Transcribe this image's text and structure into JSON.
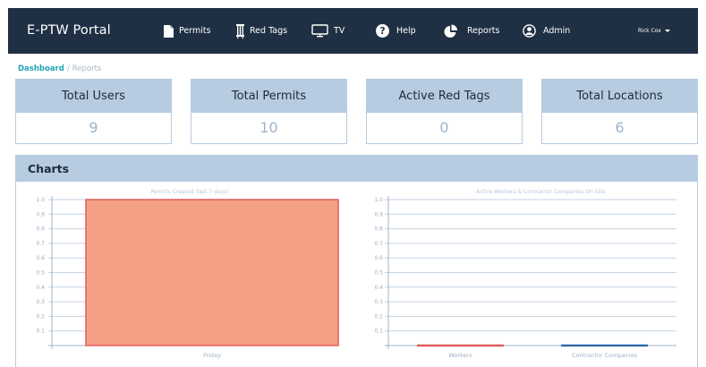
{
  "app": {
    "brand": "E-PTW Portal"
  },
  "nav": {
    "items": [
      {
        "label": "Permits",
        "icon": "document-icon"
      },
      {
        "label": "Red Tags",
        "icon": "tag-icon"
      },
      {
        "label": "TV",
        "icon": "monitor-icon"
      },
      {
        "label": "Help",
        "icon": "help-icon"
      },
      {
        "label": "Reports",
        "icon": "pie-chart-icon"
      },
      {
        "label": "Admin",
        "icon": "user-icon"
      }
    ],
    "user": "Rick Cox"
  },
  "breadcrumb": {
    "parent": "Dashboard",
    "separator": "/",
    "current": "Reports"
  },
  "stats": [
    {
      "title": "Total Users",
      "value": "9"
    },
    {
      "title": "Total Permits",
      "value": "10"
    },
    {
      "title": "Active Red Tags",
      "value": "0"
    },
    {
      "title": "Total Locations",
      "value": "6"
    }
  ],
  "charts_panel": {
    "title": "Charts"
  },
  "colors": {
    "navbar": "#1f3044",
    "card_header": "#b7cce1",
    "accent": "#22a3b8",
    "bar_fill": "#f4a086",
    "bar_stroke": "#e05a5a",
    "contractor_line": "#2f6aa8"
  },
  "chart_data": [
    {
      "type": "bar",
      "title": "Permits Created (last 7 days)",
      "categories": [
        "Friday"
      ],
      "values": [
        1
      ],
      "ylim": [
        0,
        1.0
      ],
      "yticks": [
        "1.0",
        "0.9",
        "0.8",
        "0.7",
        "0.6",
        "0.5",
        "0.4",
        "0.3",
        "0.2",
        "0.1"
      ],
      "grid": true
    },
    {
      "type": "bar",
      "title": "Active Workers & Contractor Companies On Site",
      "categories": [
        "Workers",
        "Contractor Companies"
      ],
      "values": [
        0,
        0
      ],
      "ylim": [
        0,
        1.0
      ],
      "yticks": [
        "1.0",
        "0.9",
        "0.8",
        "0.7",
        "0.6",
        "0.5",
        "0.4",
        "0.3",
        "0.2",
        "0.1"
      ],
      "grid": true
    }
  ]
}
